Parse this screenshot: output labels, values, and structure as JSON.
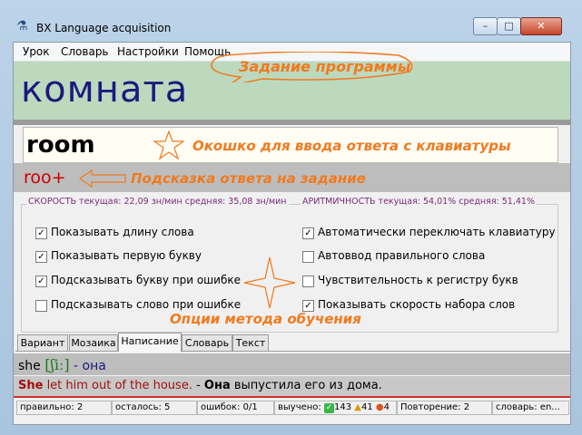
{
  "window": {
    "title": "BX Language acquisition",
    "controls": {
      "minimize": "–",
      "maximize": "□",
      "close": "✕"
    },
    "app_icon": "flask-icon"
  },
  "menu": [
    "Урок",
    "Словарь",
    "Настройки",
    "Помощь"
  ],
  "task": {
    "word": "комната"
  },
  "answer": {
    "value": "room"
  },
  "hint": {
    "text": "roo+"
  },
  "annotations": {
    "task": "Задание программы",
    "answer": "Окошко для ввода ответа с клавиатуры",
    "hint": "Подсказка ответа на задание",
    "options": "Опции метода обучения"
  },
  "speed": {
    "label": "СКОРОСТЬ текущая: 22,09 зн/мин  средняя: 35,08 зн/мин"
  },
  "rhythm": {
    "label": "АРИТМИЧНОСТЬ текущая: 54,01% средняя: 51,41%"
  },
  "options": [
    {
      "label": "Показывать длину слова",
      "checked": true
    },
    {
      "label": "Показывать первую букву",
      "checked": true
    },
    {
      "label": "Подсказывать букву при ошибке",
      "checked": true
    },
    {
      "label": "Подсказывать слово при ошибке",
      "checked": false
    },
    {
      "label": "Автоматически переключать клавиатуру",
      "checked": true
    },
    {
      "label": "Автоввод правильного слова",
      "checked": false
    },
    {
      "label": "Чувствительность к регистру букв",
      "checked": false
    },
    {
      "label": "Показывать скорость набора слов",
      "checked": true
    }
  ],
  "tabs": [
    {
      "label": "Вариант",
      "active": false
    },
    {
      "label": "Мозаика",
      "active": false
    },
    {
      "label": "Написание",
      "active": true
    },
    {
      "label": "Словарь",
      "active": false
    },
    {
      "label": "Текст",
      "active": false
    }
  ],
  "word_info": {
    "word": "she",
    "transcription": "[ʃiː]",
    "dash": "-",
    "translation": "она"
  },
  "example": {
    "en_highlight": "She",
    "en_rest": " let him out of the house.",
    "dash": " - ",
    "ru_highlight": "Она",
    "ru_rest": " выпустила его из дома."
  },
  "status": {
    "correct": "правильно: 2",
    "remaining": "осталось: 5",
    "errors": "ошибок: 0/1",
    "learned_label": "выучено:",
    "learned_ok": "143",
    "learned_warn": "41",
    "learned_fire": "4",
    "repeat": "Повторение: 2",
    "dictionary": "словарь: en..."
  },
  "colors": {
    "task_bg": "#bcd8bd",
    "task_word": "#1a1a7e",
    "hint_text": "#cc0000",
    "annotation": "#f07a1e",
    "legend": "#7a2a7a",
    "transcription": "#1a7a1a"
  }
}
